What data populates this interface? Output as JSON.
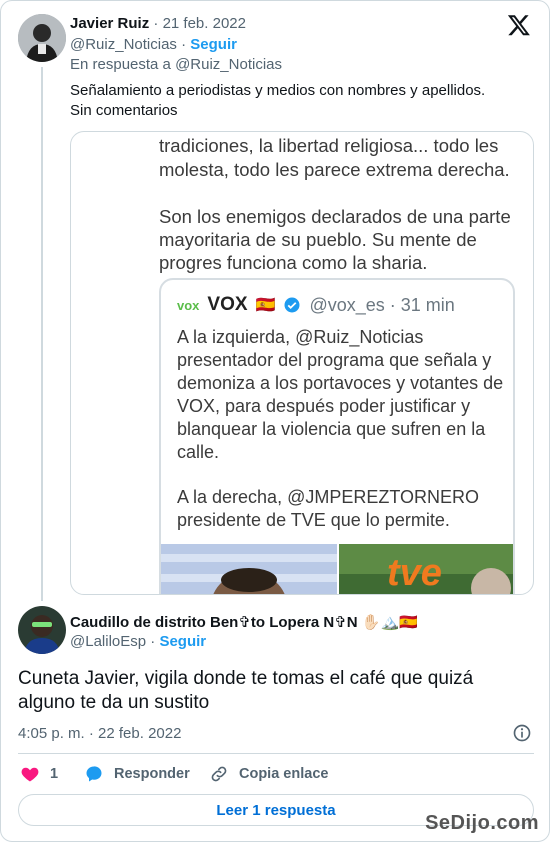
{
  "original_tweet": {
    "author_name": "Javier Ruiz",
    "date": "21 feb. 2022",
    "handle": "@Ruiz_Noticias",
    "follow_label": "Seguir",
    "reply_to": "En respuesta a @Ruiz_Noticias",
    "text_line1": "Señalamiento a periodistas y medios con nombres y apellidos.",
    "text_line2": "Sin comentarios",
    "image": {
      "line1": "tradiciones, la libertad religiosa... todo les",
      "line2": "molesta, todo les parece extrema derecha.",
      "line3": "Son los enemigos declarados de una parte",
      "line4": "mayoritaria de su pueblo. Su mente de",
      "line5": "progres funciona como la sharia.",
      "embedded": {
        "logo": "vox",
        "name": "VOX",
        "flag": "🇪🇸",
        "handle_time": "@vox_es · 31 min",
        "p1": "A la izquierda, @Ruiz_Noticias",
        "p2": "presentador del programa que señala y",
        "p3": "demoniza a los portavoces y votantes de",
        "p4": "VOX, para después poder justificar y",
        "p5": "blanquear la violencia que sufren en la",
        "p6": "calle.",
        "p7": "A la derecha, @JMPEREZTORNERO",
        "p8": "presidente de TVE que lo permite."
      },
      "tve_text": "tve"
    }
  },
  "reply_tweet": {
    "author_name": "Caudillo de distrito Ben✞to Lopera N✞N ✋🏻🏔️🇪🇸",
    "handle": "@LaliloEsp",
    "follow_label": "Seguir",
    "text": "Cuneta Javier, vigila donde te tomas el café que quizá alguno te da un sustito",
    "timestamp": "4:05 p. m. · 22 feb. 2022"
  },
  "actions": {
    "like_count": "1",
    "reply_label": "Responder",
    "copy_label": "Copia enlace",
    "read_replies_label": "Leer 1 respuesta"
  },
  "colors": {
    "accent": "#1d9bf0",
    "like": "#f91880",
    "muted": "#536471",
    "border": "#cfd9de"
  },
  "watermark": "SeDijo.com"
}
